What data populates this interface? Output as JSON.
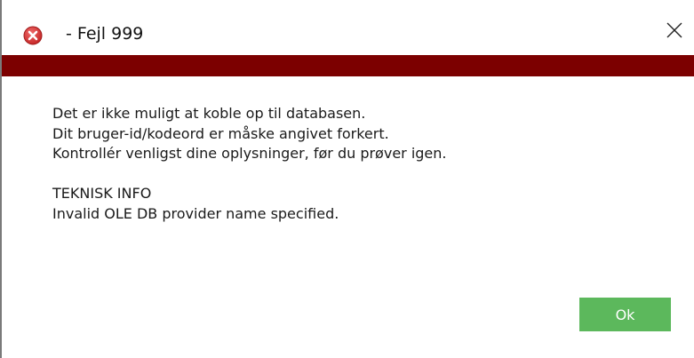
{
  "window": {
    "title": " - Fejl 999",
    "title_icon": "error-icon",
    "close_icon": "close-icon",
    "accent_color": "#7c0000"
  },
  "message": {
    "lines": [
      "Det er ikke muligt at koble op til databasen.",
      "Dit bruger-id/kodeord er måske angivet forkert.",
      "Kontrollér venligst dine oplysninger, før du prøver igen."
    ],
    "tech_heading": "TEKNISK INFO",
    "tech_detail": "Invalid OLE DB provider name specified."
  },
  "buttons": {
    "ok_label": "Ok",
    "ok_color": "#5cb85c"
  }
}
